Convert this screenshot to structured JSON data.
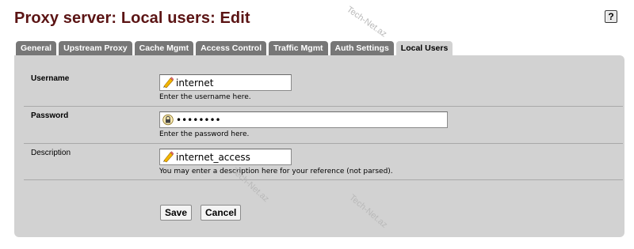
{
  "page": {
    "title": "Proxy server: Local users: Edit",
    "help_label": "?"
  },
  "tabs": [
    {
      "label": "General",
      "active": false
    },
    {
      "label": "Upstream Proxy",
      "active": false
    },
    {
      "label": "Cache Mgmt",
      "active": false
    },
    {
      "label": "Access Control",
      "active": false
    },
    {
      "label": "Traffic Mgmt",
      "active": false
    },
    {
      "label": "Auth Settings",
      "active": false
    },
    {
      "label": "Local Users",
      "active": true
    }
  ],
  "form": {
    "username": {
      "label": "Username",
      "value": "internet",
      "hint": "Enter the username here.",
      "icon": "pencil-icon"
    },
    "password": {
      "label": "Password",
      "value": "••••••••",
      "hint": "Enter the password here.",
      "icon": "lock-icon"
    },
    "description": {
      "label": "Description",
      "value": "internet_access",
      "hint": "You may enter a description here for your reference (not parsed).",
      "icon": "pencil-icon"
    },
    "save_label": "Save",
    "cancel_label": "Cancel"
  },
  "watermark": "Tech-Net.az",
  "colors": {
    "title": "#5b1414",
    "tab_inactive": "#777777",
    "panel": "#d2d2d2"
  }
}
